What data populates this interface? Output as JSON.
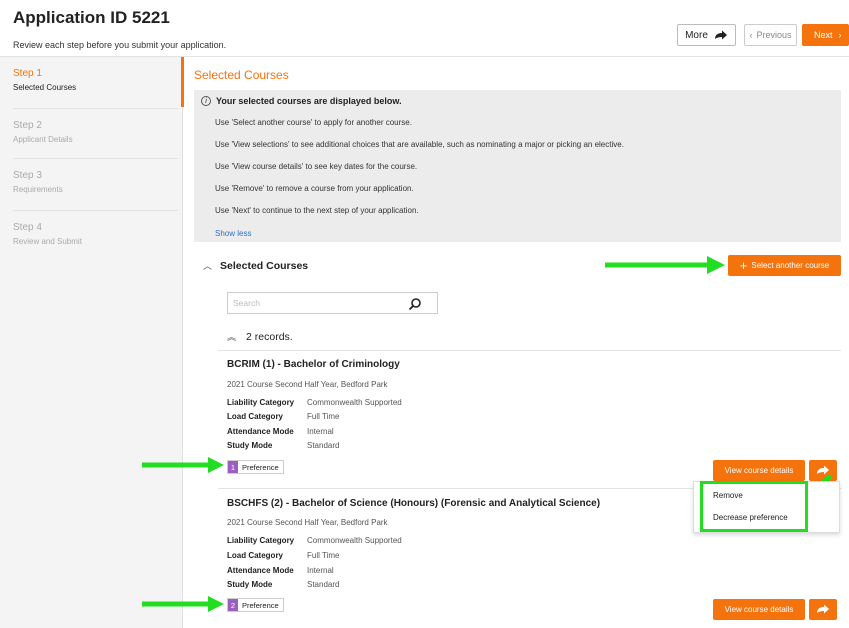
{
  "header": {
    "title": "Application ID 5221",
    "subtitle": "Review each step before you submit your application.",
    "more_label": "More",
    "previous_label": "Previous",
    "next_label": "Next"
  },
  "sidebar": {
    "steps": [
      {
        "number": "Step 1",
        "label": "Selected Courses",
        "active": true
      },
      {
        "number": "Step 2",
        "label": "Applicant Details",
        "active": false
      },
      {
        "number": "Step 3",
        "label": "Requirements",
        "active": false
      },
      {
        "number": "Step 4",
        "label": "Review and Submit",
        "active": false
      }
    ]
  },
  "main": {
    "title": "Selected Courses",
    "info": {
      "heading": "Your selected courses are displayed below.",
      "lines": [
        "Use 'Select another course' to apply for another course.",
        "Use 'View selections' to see additional choices that are available, such as nominating a major or picking an elective.",
        "Use 'View course details' to see key dates for the course.",
        "Use 'Remove' to remove a course from your application.",
        "Use 'Next' to continue to the next step of your application."
      ],
      "show_less": "Show less"
    },
    "section_title": "Selected Courses",
    "select_another_label": "Select another course",
    "search_placeholder": "Search",
    "records_label": "2 records.",
    "courses": [
      {
        "title": "BCRIM (1) - Bachelor of Criminology",
        "subtitle": "2021 Course Second Half Year, Bedford Park",
        "fields": [
          {
            "k": "Liability Category",
            "v": "Commonwealth Supported"
          },
          {
            "k": "Load Category",
            "v": "Full Time"
          },
          {
            "k": "Attendance Mode",
            "v": "Internal"
          },
          {
            "k": "Study Mode",
            "v": "Standard"
          }
        ],
        "preference_number": "1",
        "preference_label": "Preference",
        "details_label": "View course details"
      },
      {
        "title": "BSCHFS (2) - Bachelor of Science (Honours) (Forensic and Analytical Science)",
        "subtitle": "2021 Course Second Half Year, Bedford Park",
        "fields": [
          {
            "k": "Liability Category",
            "v": "Commonwealth Supported"
          },
          {
            "k": "Load Category",
            "v": "Full Time"
          },
          {
            "k": "Attendance Mode",
            "v": "Internal"
          },
          {
            "k": "Study Mode",
            "v": "Standard"
          }
        ],
        "preference_number": "2",
        "preference_label": "Preference",
        "details_label": "View course details"
      }
    ],
    "dropdown": {
      "items": [
        "Remove",
        "Decrease preference"
      ]
    }
  },
  "colors": {
    "accent": "#f5730c",
    "annotation_green": "#22dd22",
    "preference_purple": "#9b5fc0",
    "link_blue": "#2a73c9"
  },
  "icons": [
    "info-icon",
    "more-arrow-icon",
    "chevron-left-icon",
    "chevron-right-icon",
    "chevron-up-icon",
    "plus-icon",
    "search-icon",
    "double-chevron-up-icon",
    "action-arrow-icon"
  ]
}
